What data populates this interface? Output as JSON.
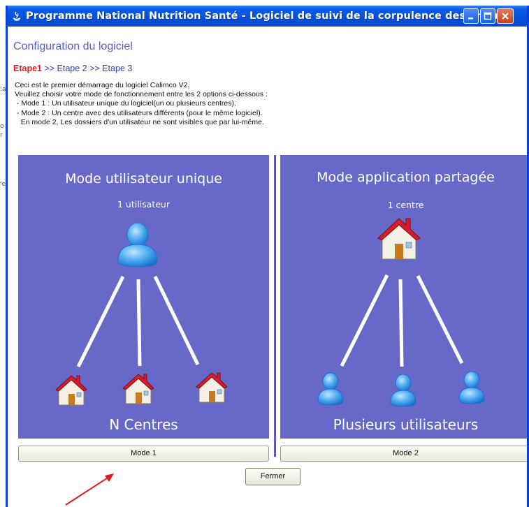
{
  "window": {
    "title": "Programme National Nutrition Santé - Logiciel de suivi de la corpulence des enfants"
  },
  "page": {
    "heading": "Configuration du logiciel",
    "steps": [
      {
        "label": "Etape1",
        "active": true
      },
      {
        "label": " >> Etape 2",
        "active": false
      },
      {
        "label": " >> Etape 3",
        "active": false
      }
    ],
    "intro_lines": [
      "Ceci est le premier démarrage du logiciel Calimco V2.",
      "Veuillez choisir votre mode de fonctionnement entre les 2 options ci-dessous :",
      " - Mode 1 : Un utilisateur unique du logiciel(un ou plusieurs centres).",
      " - Mode 2 : Un centre avec des utilisateurs différents (pour le même logiciel).",
      "   En mode 2, Les dossiers d'un utilisateur ne sont visibles que par lui-même."
    ]
  },
  "mode1": {
    "title": "Mode utilisateur unique",
    "top_caption": "1 utilisateur",
    "bottom_caption": "N Centres",
    "button_label": "Mode 1"
  },
  "mode2": {
    "title": "Mode application partagée",
    "top_caption": "1 centre",
    "bottom_caption": "Plusieurs utilisateurs",
    "button_label": "Mode 2"
  },
  "footer": {
    "close_label": "Fermer"
  },
  "icons": [
    "java-app-icon",
    "minimize-icon",
    "maximize-icon",
    "close-icon",
    "user-icon",
    "house-icon"
  ],
  "colors": {
    "panel": "#6868c8",
    "title_bar": "#0551d8",
    "step_active": "#e11b1b",
    "step_link": "#2b3fc8",
    "annotation_arrow": "#e11b1b"
  }
}
